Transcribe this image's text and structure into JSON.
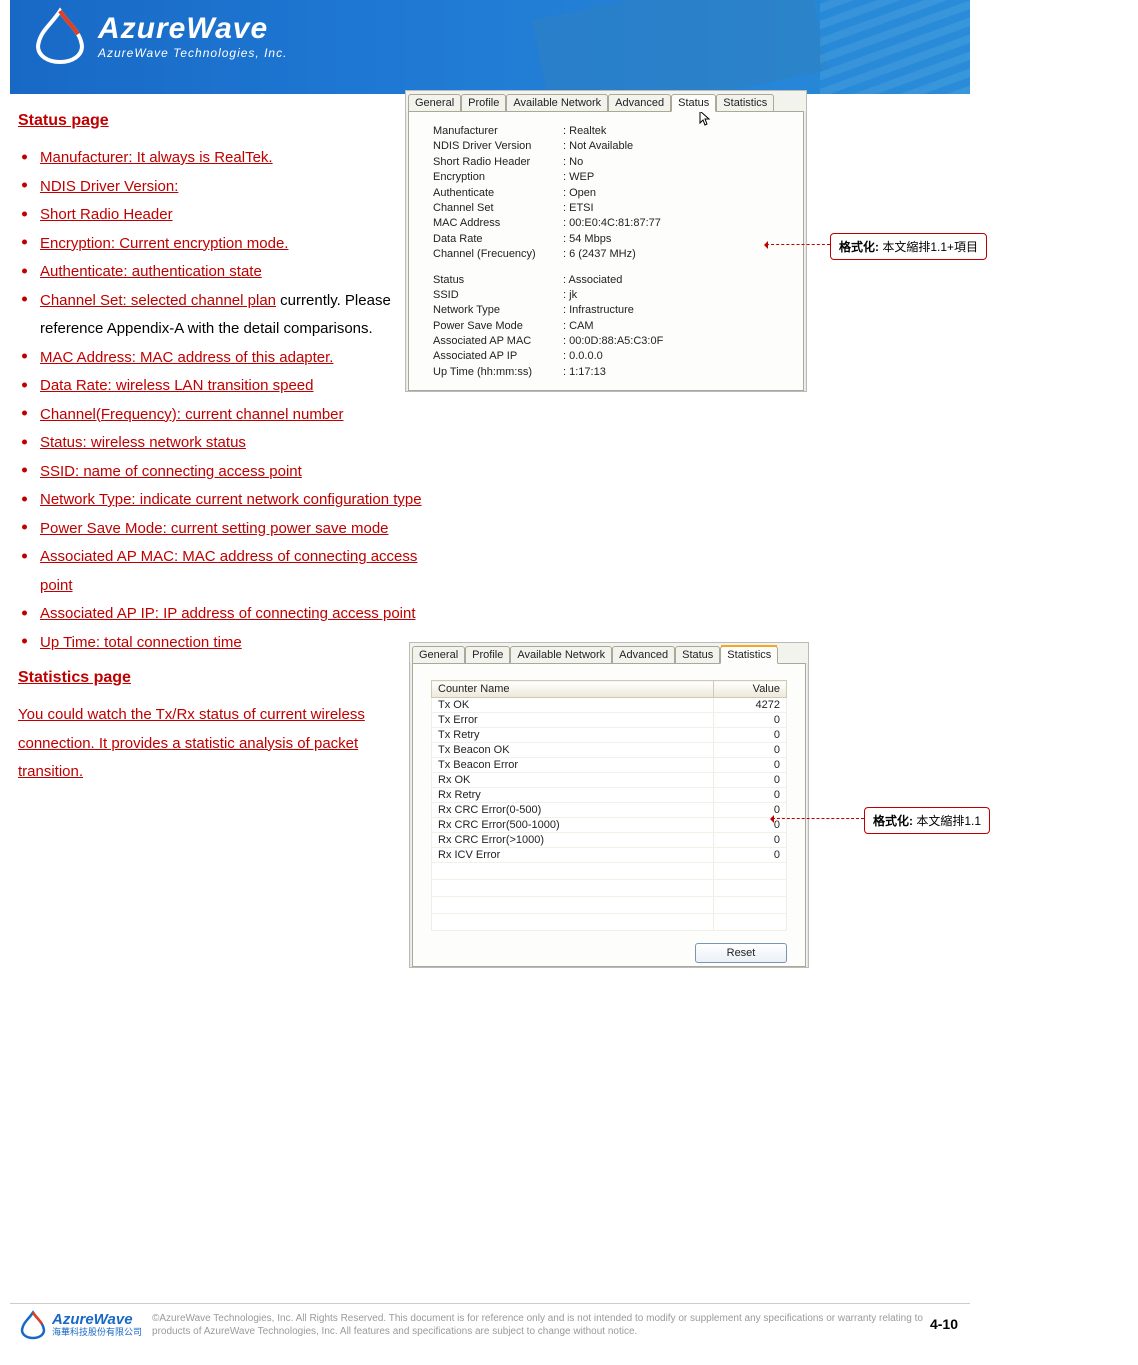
{
  "header": {
    "brand_big": "AzureWave",
    "brand_small": "AzureWave  Technologies,  Inc."
  },
  "section1_title": "Status page",
  "status_list": [
    {
      "link": "Manufacturer: It always is RealTek."
    },
    {
      "link": "NDIS Driver Version:"
    },
    {
      "link": "Short Radio Header"
    },
    {
      "link": "Encryption: Current encryption mode."
    },
    {
      "link": "Authenticate: authentication state"
    },
    {
      "link": "Channel Set: selected channel plan",
      "tail": " currently. Please reference Appendix-A with the detail comparisons."
    },
    {
      "link": "MAC Address: MAC address of this adapter."
    },
    {
      "link": "Data Rate: wireless LAN transition speed"
    },
    {
      "link": "Channel(Frequency): current channel number"
    },
    {
      "link": "Status: wireless network status"
    },
    {
      "link": "SSID: name of connecting access point"
    },
    {
      "link": "Network Type: indicate current network configuration type"
    },
    {
      "link": "Power Save Mode: current setting power save mode"
    },
    {
      "link": "Associated AP MAC: MAC address of connecting access point"
    },
    {
      "link": "Associated AP IP: IP address of connecting access point"
    },
    {
      "link": "Up Time: total connection time"
    }
  ],
  "section2_title": "Statistics page",
  "section2_body": "You could watch the Tx/Rx status of current wireless connection. It provides a statistic analysis of packet transition.",
  "tabs": [
    "General",
    "Profile",
    "Available Network",
    "Advanced",
    "Status",
    "Statistics"
  ],
  "status_kv_top": [
    {
      "k": "Manufacturer",
      "v": "Realtek"
    },
    {
      "k": "NDIS Driver Version",
      "v": "Not Available"
    },
    {
      "k": "Short Radio Header",
      "v": "No"
    },
    {
      "k": "Encryption",
      "v": "WEP"
    },
    {
      "k": "Authenticate",
      "v": "Open"
    },
    {
      "k": "Channel Set",
      "v": "ETSI"
    },
    {
      "k": "MAC Address",
      "v": "00:E0:4C:81:87:77"
    },
    {
      "k": "Data Rate",
      "v": "54 Mbps"
    },
    {
      "k": "Channel (Frecuency)",
      "v": "6 (2437 MHz)"
    }
  ],
  "status_kv_bottom": [
    {
      "k": "Status",
      "v": "Associated"
    },
    {
      "k": "SSID",
      "v": "jk"
    },
    {
      "k": "Network Type",
      "v": "Infrastructure"
    },
    {
      "k": "Power Save Mode",
      "v": "CAM"
    },
    {
      "k": "Associated AP MAC",
      "v": "00:0D:88:A5:C3:0F"
    },
    {
      "k": "Associated AP IP",
      "v": "0.0.0.0"
    },
    {
      "k": "Up Time (hh:mm:ss)",
      "v": "1:17:13"
    }
  ],
  "stats_headers": {
    "name": "Counter Name",
    "value": "Value"
  },
  "stats_rows": [
    {
      "name": "Tx OK",
      "value": "4272"
    },
    {
      "name": "Tx Error",
      "value": "0"
    },
    {
      "name": "Tx Retry",
      "value": "0"
    },
    {
      "name": "Tx Beacon OK",
      "value": "0"
    },
    {
      "name": "Tx Beacon Error",
      "value": "0"
    },
    {
      "name": "Rx OK",
      "value": "0"
    },
    {
      "name": "Rx Retry",
      "value": "0"
    },
    {
      "name": "Rx CRC Error(0-500)",
      "value": "0"
    },
    {
      "name": "Rx CRC Error(500-1000)",
      "value": "0"
    },
    {
      "name": "Rx CRC Error(>1000)",
      "value": "0"
    },
    {
      "name": "Rx ICV Error",
      "value": "0"
    }
  ],
  "reset_label": "Reset",
  "callout1": {
    "bold": "格式化:",
    "rest": " 本文縮排1.1+項目"
  },
  "callout2": {
    "bold": "格式化:",
    "rest": " 本文縮排1.1"
  },
  "footer": {
    "brand_big": "AzureWave",
    "brand_small": "海華科技股份有限公司",
    "legal": "©AzureWave Technologies, Inc. All Rights Reserved. This document is for reference only and is not intended to modify or supplement any specifications or warranty relating to products of AzureWave Technologies, Inc. All features and specifications are subject to change without notice.",
    "pagenum": "4-10"
  }
}
